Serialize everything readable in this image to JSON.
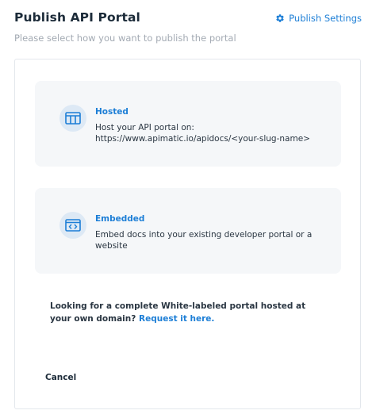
{
  "header": {
    "title": "Publish API Portal",
    "settings_label": "Publish Settings",
    "subtitle": "Please select how you want to publish the portal"
  },
  "options": [
    {
      "title": "Hosted",
      "description": "Host your API portal on: https://www.apimatic.io/apidocs/<your-slug-name>",
      "icon": "browser-layout-icon"
    },
    {
      "title": "Embedded",
      "description": "Embed docs into your existing developer portal or a website",
      "icon": "embed-code-icon"
    }
  ],
  "note": {
    "text": "Looking for a complete White-labeled portal hosted at your own domain?",
    "link": "Request it here."
  },
  "footer": {
    "cancel_label": "Cancel"
  },
  "colors": {
    "accent": "#1c7ed6",
    "card_bg": "#f5f7f9",
    "icon_bg": "#dde9f5"
  }
}
